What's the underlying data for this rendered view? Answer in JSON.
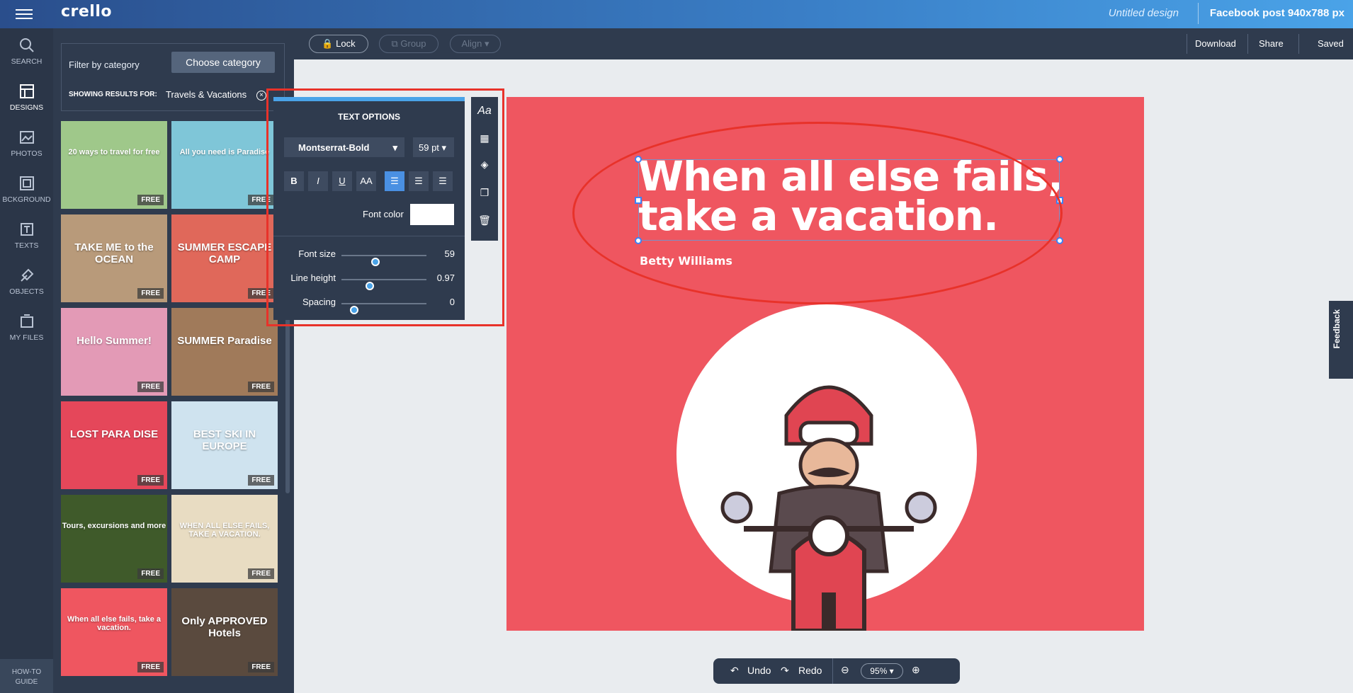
{
  "app": {
    "logo": "crello",
    "doc_title": "Untitled design",
    "doc_size": "Facebook post 940x788 px"
  },
  "sidebar": {
    "items": [
      {
        "label": "SEARCH",
        "icon": "search-icon"
      },
      {
        "label": "DESIGNS",
        "icon": "designs-icon"
      },
      {
        "label": "PHOTOS",
        "icon": "photos-icon"
      },
      {
        "label": "BCKGROUND",
        "icon": "background-icon"
      },
      {
        "label": "TEXTS",
        "icon": "texts-icon"
      },
      {
        "label": "OBJECTS",
        "icon": "objects-icon"
      },
      {
        "label": "MY FILES",
        "icon": "my-files-icon"
      }
    ],
    "active": "DESIGNS",
    "howto_line1": "HOW-TO",
    "howto_line2": "GUIDE"
  },
  "panel": {
    "filter_label": "Filter by category",
    "choose_label": "Choose category",
    "showing_label": "SHOWING RESULTS FOR:",
    "showing_value": "Travels & Vacations",
    "free_badge": "FREE",
    "thumbs": [
      {
        "text": "20 ways to travel for free",
        "color": "#9fc88a"
      },
      {
        "text": "All you need is Paradise",
        "color": "#7fc6d8"
      },
      {
        "text": "TAKE ME to the OCEAN",
        "color": "#b89a7a"
      },
      {
        "text": "SUMMER ESCAPE CAMP",
        "color": "#e0685a"
      },
      {
        "text": "Hello Summer!",
        "color": "#e39ab6"
      },
      {
        "text": "SUMMER Paradise",
        "color": "#a07a5a"
      },
      {
        "text": "LOST PARA DISE",
        "color": "#e5475a"
      },
      {
        "text": "BEST SKI IN EUROPE",
        "color": "#cfe3ef"
      },
      {
        "text": "Tours, excursions and more",
        "color": "#3f5a2a"
      },
      {
        "text": "WHEN ALL ELSE FAILS, TAKE A VACATION.",
        "color": "#e8dcc2"
      },
      {
        "text": "When all else fails, take a vacation.",
        "color": "#ef5660"
      },
      {
        "text": "Only APPROVED Hotels",
        "color": "#5a4a3e"
      }
    ]
  },
  "toolbar": {
    "lock": "Lock",
    "group": "Group",
    "align": "Align",
    "download": "Download",
    "share": "Share",
    "saved": "Saved"
  },
  "design": {
    "quote_line1": "When all else fails,",
    "quote_line2": "take a vacation.",
    "author": "Betty Williams"
  },
  "text_options": {
    "title": "TEXT OPTIONS",
    "font": "Montserrat-Bold",
    "size": "59 pt",
    "bold": "B",
    "italic": "I",
    "underline": "U",
    "caps": "AA",
    "font_color_label": "Font color",
    "font_color": "#ffffff",
    "font_size_label": "Font size",
    "font_size_value": "59",
    "font_size_level": 0.4,
    "line_height_label": "Line height",
    "line_height_value": "0.97",
    "line_height_level": 0.33,
    "spacing_label": "Spacing",
    "spacing_value": "0",
    "spacing_level": 0.15
  },
  "side_tools": {
    "text_tool": "Aa"
  },
  "feedback": "Feedback",
  "bottombar": {
    "undo": "Undo",
    "redo": "Redo",
    "zoom": "95%"
  }
}
